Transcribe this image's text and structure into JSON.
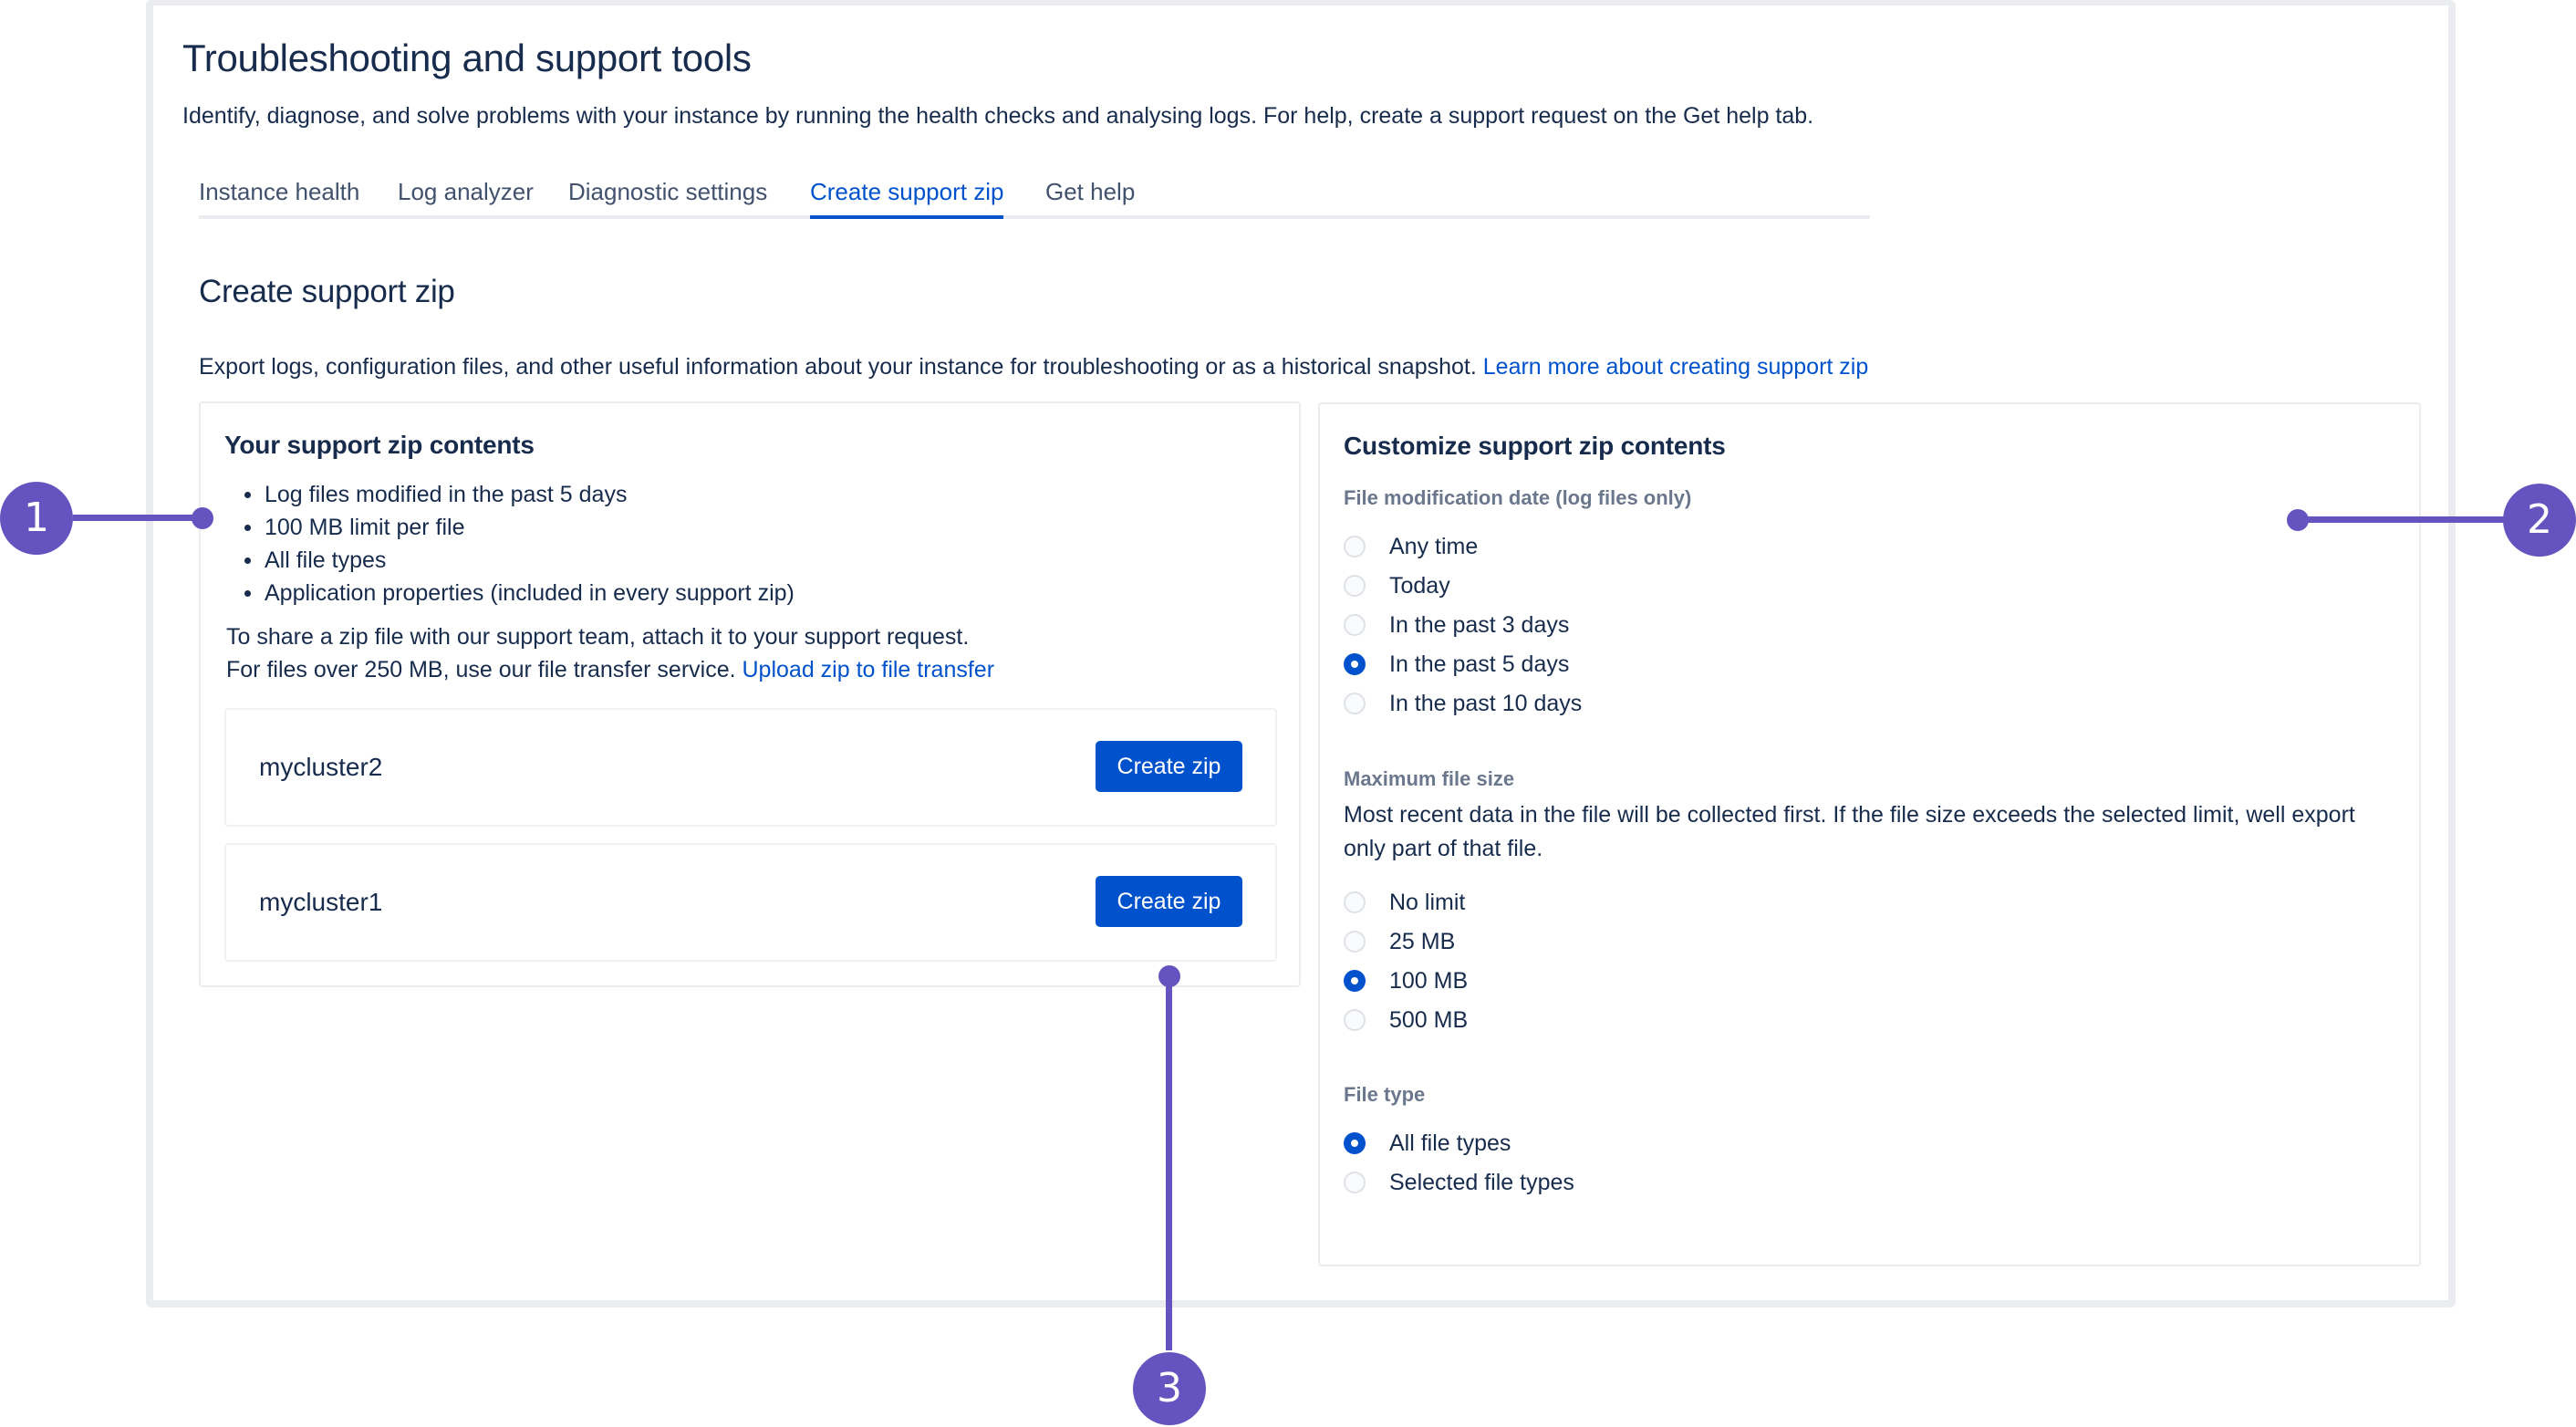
{
  "header": {
    "title": "Troubleshooting and support tools",
    "description": "Identify, diagnose, and solve problems with your instance by running the health checks and analysing logs. For help, create a support request on the Get help tab."
  },
  "tabs": [
    {
      "label": "Instance health",
      "active": false
    },
    {
      "label": "Log analyzer",
      "active": false
    },
    {
      "label": "Diagnostic settings",
      "active": false
    },
    {
      "label": "Create support zip",
      "active": true
    },
    {
      "label": "Get help",
      "active": false
    }
  ],
  "section": {
    "title": "Create support zip",
    "description": "Export logs, configuration files, and other useful information about your instance for troubleshooting or as a historical snapshot.",
    "learn_more_link": "Learn more about creating support zip"
  },
  "contents_card": {
    "title": "Your support zip contents",
    "bullets": [
      "Log files modified in the past 5 days",
      "100 MB limit per file",
      "All file types",
      "Application properties (included in every support zip)"
    ],
    "share_line_1": "To share a zip file with our support team, attach it to your support request.",
    "share_line_2": "For files over 250 MB, use our file transfer service.",
    "upload_link": "Upload zip to file transfer",
    "clusters": [
      {
        "name": "mycluster2",
        "button_label": "Create zip"
      },
      {
        "name": "mycluster1",
        "button_label": "Create zip"
      }
    ]
  },
  "customize_card": {
    "title": "Customize support zip contents",
    "modification_date": {
      "label": "File modification date (log files only)",
      "options": [
        "Any time",
        "Today",
        "In the past 3 days",
        "In the past 5 days",
        "In the past 10 days"
      ],
      "selected": "In the past 5 days"
    },
    "max_file_size": {
      "label": "Maximum file size",
      "help": "Most recent data in the file will be collected first. If the file size exceeds the selected limit, well export only part of that file.",
      "options": [
        "No limit",
        "25 MB",
        "100 MB",
        "500 MB"
      ],
      "selected": "100 MB"
    },
    "file_type": {
      "label": "File type",
      "options": [
        "All file types",
        "Selected file types"
      ],
      "selected": "All file types"
    }
  },
  "callouts": [
    "1",
    "2",
    "3"
  ],
  "colors": {
    "accent_blue": "#0052CC",
    "text_primary": "#172B4D",
    "text_tab": "#42526E",
    "text_subtle": "#6B778C",
    "callout_purple": "#6554C0",
    "border": "#EBECF0"
  }
}
